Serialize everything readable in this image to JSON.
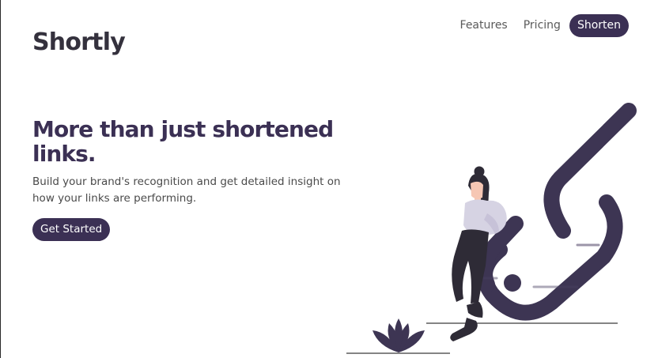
{
  "brand": {
    "logo": "Shortly"
  },
  "nav": {
    "links": [
      "Features",
      "Pricing"
    ],
    "cta_label": "Shorten"
  },
  "hero": {
    "headline": "More than just shortened links.",
    "subtext": "Build your brand's recognition and get detailed insight on how your links are performing.",
    "cta_label": "Get Started"
  },
  "colors": {
    "primary": "#3b3054",
    "text_dark": "#34313d",
    "text_muted": "#4a4a4a",
    "figure_shirt": "#d6d3e3",
    "figure_skin": "#f6c7b4",
    "figure_dark": "#2e2b36"
  },
  "illustration": {
    "icon": "person-with-link-illustration"
  }
}
